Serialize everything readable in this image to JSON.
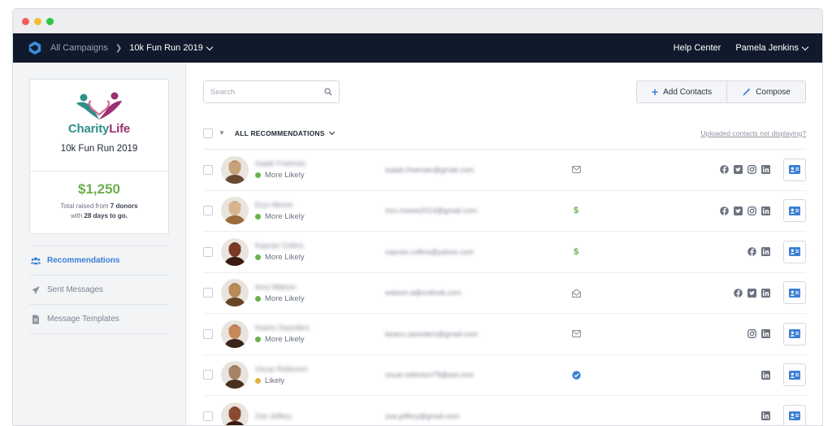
{
  "topnav": {
    "breadcrumb_root": "All Campaigns",
    "breadcrumb_current": "10k Fun Run 2019",
    "help_center": "Help Center",
    "user_name": "Pamela Jenkins"
  },
  "campaign_card": {
    "org_name_part1": "Charity",
    "org_name_part2": "Life",
    "campaign_name": "10k Fun Run 2019",
    "raised_amount": "$1,250",
    "raised_prefix": "Total raised from",
    "donors": "7 donors",
    "with_text": "with",
    "days": "28 days to go."
  },
  "sidebar": {
    "items": [
      {
        "label": "Recommendations",
        "icon": "users-icon"
      },
      {
        "label": "Sent Messages",
        "icon": "paper-plane-icon"
      },
      {
        "label": "Message Templates",
        "icon": "document-icon"
      }
    ]
  },
  "toolbar": {
    "search_placeholder": "Search",
    "add_contacts_label": "Add Contacts",
    "compose_label": "Compose"
  },
  "list": {
    "filter_label": "ALL RECOMMENDATIONS",
    "help_link": "Uploaded contacts not displaying?",
    "rows": [
      {
        "name": "Isaiah Freeman",
        "likelihood": "More Likely",
        "likelihood_color": "#6ab04c",
        "email": "isaiah.freeman@gmail.com",
        "status": "envelope-icon",
        "socials": [
          "facebook-icon",
          "twitter-icon",
          "instagram-icon",
          "linkedin-icon"
        ],
        "avatar_bg": "#c9a178",
        "avatar_fg": "#6a4a34"
      },
      {
        "name": "Eryn Moore",
        "likelihood": "More Likely",
        "likelihood_color": "#6ab04c",
        "email": "mrs.moore2014@gmail.com",
        "status": "dollar-icon",
        "socials": [
          "facebook-icon",
          "twitter-icon",
          "instagram-icon",
          "linkedin-icon"
        ],
        "avatar_bg": "#d9b58f",
        "avatar_fg": "#9a6b3c"
      },
      {
        "name": "Kaycee Collins",
        "likelihood": "More Likely",
        "likelihood_color": "#6ab04c",
        "email": "caycee.collins@yahoo.com",
        "status": "dollar-icon",
        "socials": [
          "facebook-icon",
          "linkedin-icon"
        ],
        "avatar_bg": "#7a3a28",
        "avatar_fg": "#3a1a10"
      },
      {
        "name": "Amy Watson",
        "likelihood": "More Likely",
        "likelihood_color": "#6ab04c",
        "email": "watson.a@outlook.com",
        "status": "envelope-open-icon",
        "socials": [
          "facebook-icon",
          "twitter-icon",
          "linkedin-icon"
        ],
        "avatar_bg": "#b98a5a",
        "avatar_fg": "#6a4524"
      },
      {
        "name": "Keanu Saunders",
        "likelihood": "More Likely",
        "likelihood_color": "#6ab04c",
        "email": "keanu.saunders@gmail.com",
        "status": "envelope-icon",
        "socials": [
          "instagram-icon",
          "linkedin-icon"
        ],
        "avatar_bg": "#c8885a",
        "avatar_fg": "#3a2418"
      },
      {
        "name": "Oscar Robinson",
        "likelihood": "Likely",
        "likelihood_color": "#e0b040",
        "email": "oscar.robinson79@aol.com",
        "status": "check-circle-icon",
        "socials": [
          "linkedin-icon"
        ],
        "avatar_bg": "#a68468",
        "avatar_fg": "#4a3020"
      },
      {
        "name": "Zoe Jeffery",
        "likelihood": "",
        "likelihood_color": "#e0b040",
        "email": "zoe.jeffery@gmail.com",
        "status": "",
        "socials": [
          "linkedin-icon"
        ],
        "avatar_bg": "#8a4a30",
        "avatar_fg": "#3a1a10"
      }
    ]
  },
  "colors": {
    "nav_bg": "#111a2c",
    "accent_blue": "#3a7fd5",
    "accent_green": "#6ab04c",
    "likely_yellow": "#e0b040"
  }
}
